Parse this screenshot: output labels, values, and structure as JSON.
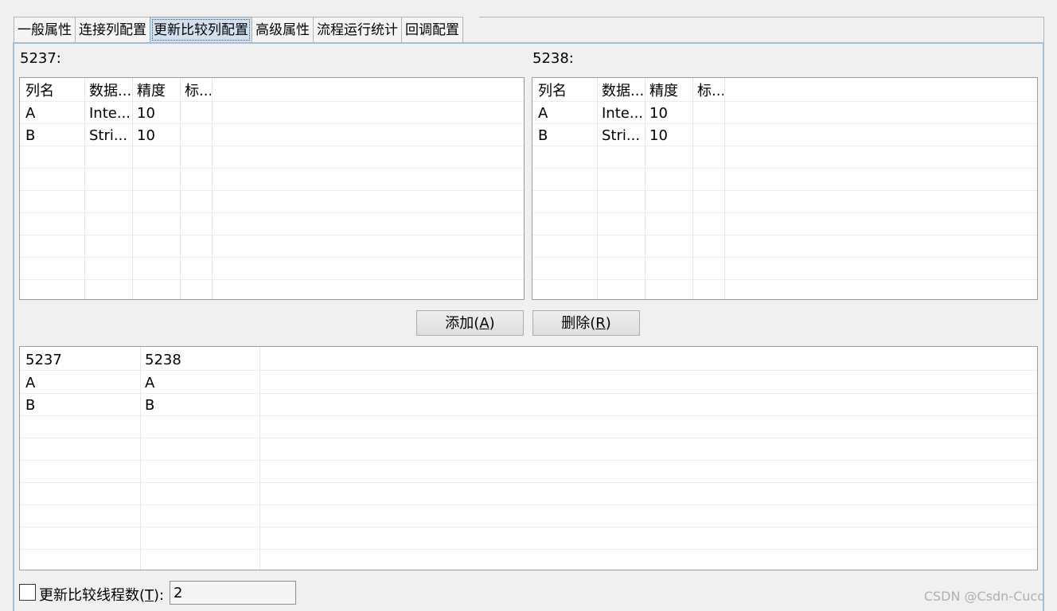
{
  "tabs": [
    "一般属性",
    "连接列配置",
    "更新比较列配置",
    "高级属性",
    "流程运行统计",
    "回调配置"
  ],
  "left_table": {
    "label": "5237:",
    "headers": [
      "列名",
      "数据...",
      "精度",
      "标..."
    ],
    "rows": [
      [
        "A",
        "Inte...",
        "10",
        ""
      ],
      [
        "B",
        "Stri...",
        "10",
        ""
      ]
    ]
  },
  "right_table": {
    "label": "5238:",
    "headers": [
      "列名",
      "数据...",
      "精度",
      "标..."
    ],
    "rows": [
      [
        "A",
        "Inte...",
        "10",
        ""
      ],
      [
        "B",
        "Stri...",
        "10",
        ""
      ]
    ]
  },
  "buttons": {
    "add": {
      "text": "添加(",
      "mnemonic": "A",
      "suffix": ")"
    },
    "delete": {
      "text": "删除(",
      "mnemonic": "R",
      "suffix": ")"
    }
  },
  "mapping_table": {
    "headers": [
      "5237",
      "5238"
    ],
    "rows": [
      [
        "A",
        "A"
      ],
      [
        "B",
        "B"
      ]
    ]
  },
  "thread_option": {
    "label": "更新比较线程数(",
    "mnemonic": "T",
    "suffix": "):",
    "checked": false,
    "value": "2"
  },
  "watermark": "CSDN @Csdn-Cuco"
}
